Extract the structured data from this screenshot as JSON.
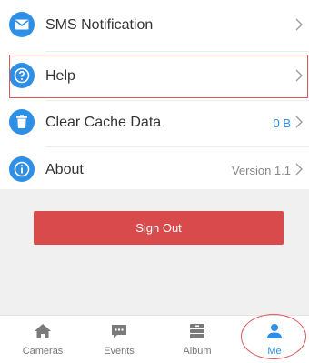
{
  "menu": {
    "items": [
      {
        "label": "SMS Notification",
        "value": "",
        "icon": "envelope-icon"
      },
      {
        "label": "Help",
        "value": "",
        "icon": "question-icon"
      },
      {
        "label": "Clear Cache Data",
        "value": "0 B",
        "icon": "trash-icon"
      },
      {
        "label": "About",
        "value": "Version 1.1",
        "icon": "info-icon"
      }
    ]
  },
  "actions": {
    "sign_out_label": "Sign Out"
  },
  "tabbar": {
    "tabs": [
      {
        "label": "Cameras",
        "icon": "home-icon"
      },
      {
        "label": "Events",
        "icon": "chat-icon"
      },
      {
        "label": "Album",
        "icon": "album-icon"
      },
      {
        "label": "Me",
        "icon": "person-icon"
      }
    ],
    "active": "Me"
  },
  "colors": {
    "accent": "#2e8fe6",
    "signout": "#d94a4c",
    "highlight": "#d9595d",
    "cache_value": "#2e8fe6",
    "version_value": "#888888"
  }
}
